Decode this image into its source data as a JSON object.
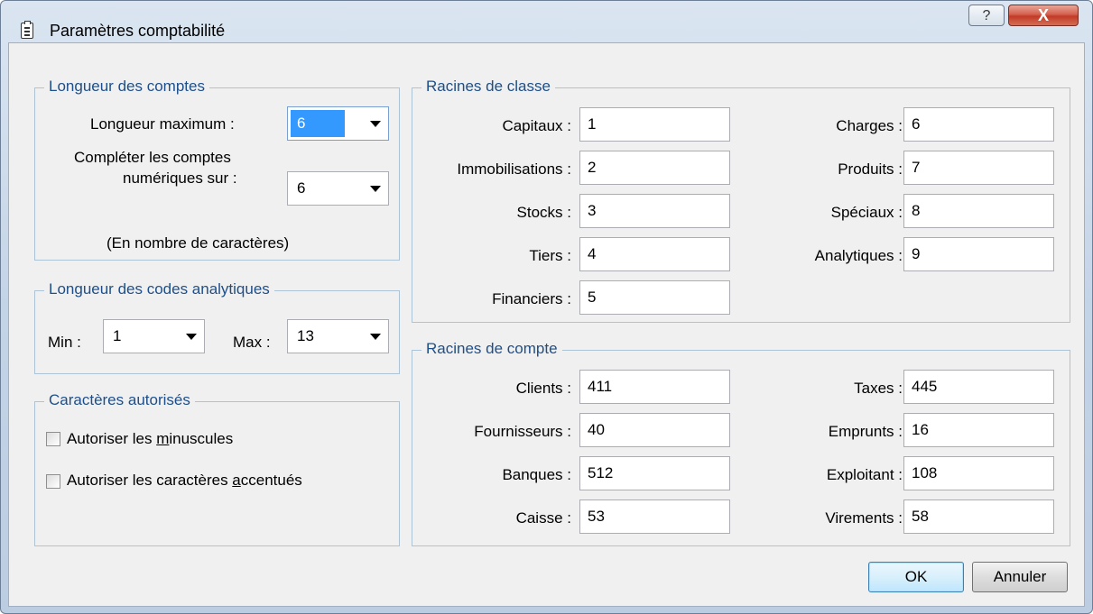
{
  "window": {
    "title": "Paramètres comptabilité",
    "help_label": "?",
    "close_label": "X"
  },
  "longueur_comptes": {
    "legend": "Longueur des comptes",
    "max_label": "Longueur maximum :",
    "max_value": "6",
    "completer_label_1": "Compléter les comptes",
    "completer_label_2": "numériques sur :",
    "completer_value": "6",
    "note": "(En nombre de caractères)"
  },
  "codes_analytiques": {
    "legend": "Longueur des codes analytiques",
    "min_label": "Min :",
    "min_value": "1",
    "max_label": "Max :",
    "max_value": "13"
  },
  "caracteres": {
    "legend": "Caractères autorisés",
    "minuscules_pre": "Autoriser les ",
    "minuscules_key": "m",
    "minuscules_post": "inuscules",
    "minuscules_checked": false,
    "accentues_pre": "Autoriser les caractères ",
    "accentues_key": "a",
    "accentues_post": "ccentués",
    "accentues_checked": false
  },
  "racines_classe": {
    "legend": "Racines de classe",
    "left": [
      {
        "label": "Capitaux :",
        "value": "1"
      },
      {
        "label": "Immobilisations :",
        "value": "2"
      },
      {
        "label": "Stocks :",
        "value": "3"
      },
      {
        "label": "Tiers :",
        "value": "4"
      },
      {
        "label": "Financiers :",
        "value": "5"
      }
    ],
    "right": [
      {
        "label": "Charges :",
        "value": "6"
      },
      {
        "label": "Produits :",
        "value": "7"
      },
      {
        "label": "Spéciaux :",
        "value": "8"
      },
      {
        "label": "Analytiques :",
        "value": "9"
      }
    ]
  },
  "racines_compte": {
    "legend": "Racines de compte",
    "left": [
      {
        "label": "Clients :",
        "value": "411"
      },
      {
        "label": "Fournisseurs :",
        "value": "40"
      },
      {
        "label": "Banques :",
        "value": "512"
      },
      {
        "label": "Caisse :",
        "value": "53"
      }
    ],
    "right": [
      {
        "label": "Taxes :",
        "value": "445"
      },
      {
        "label": "Emprunts :",
        "value": "16"
      },
      {
        "label": "Exploitant :",
        "value": "108"
      },
      {
        "label": "Virements :",
        "value": "58"
      }
    ]
  },
  "buttons": {
    "ok": "OK",
    "cancel": "Annuler"
  }
}
